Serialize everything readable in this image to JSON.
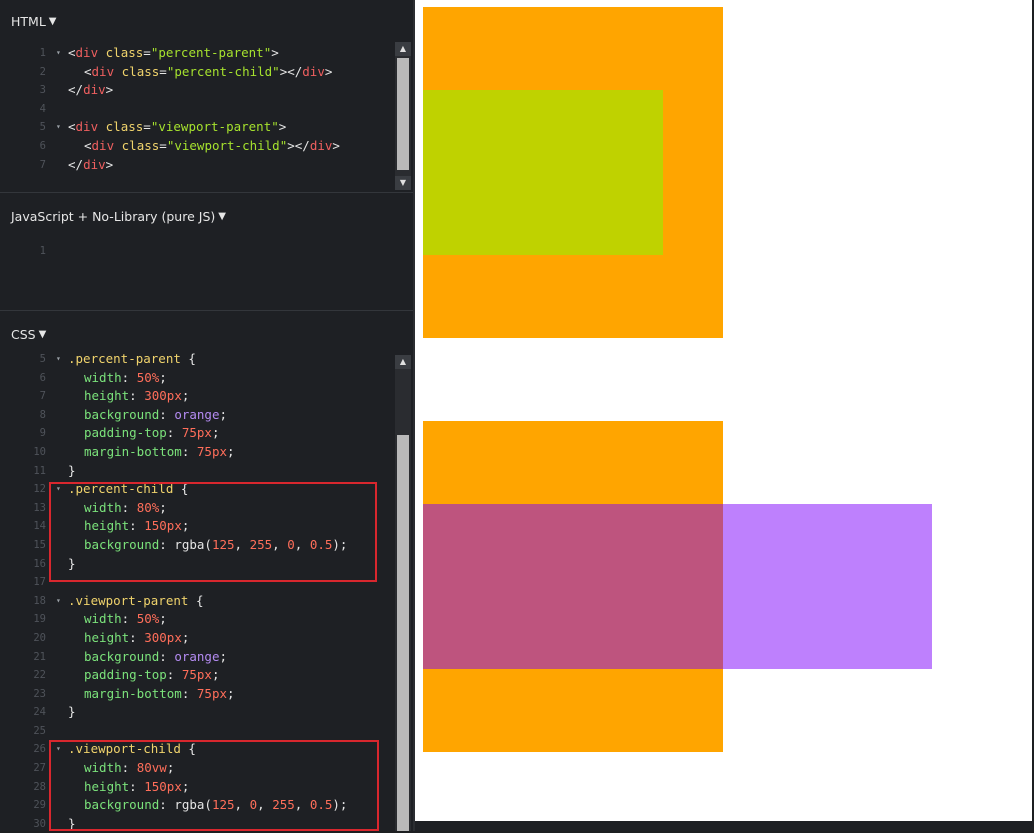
{
  "html_panel": {
    "title": "HTML",
    "lines": [
      {
        "n": "1",
        "indent": 0,
        "fold": true,
        "tokens": [
          [
            "t-plain",
            "<"
          ],
          [
            "t-tag",
            "div"
          ],
          [
            "t-plain",
            " "
          ],
          [
            "t-attr",
            "class"
          ],
          [
            "t-plain",
            "="
          ],
          [
            "t-str",
            "\"percent-parent\""
          ],
          [
            "t-plain",
            ">"
          ]
        ]
      },
      {
        "n": "2",
        "indent": 1,
        "fold": false,
        "tokens": [
          [
            "t-plain",
            "<"
          ],
          [
            "t-tag",
            "div"
          ],
          [
            "t-plain",
            " "
          ],
          [
            "t-attr",
            "class"
          ],
          [
            "t-plain",
            "="
          ],
          [
            "t-str",
            "\"percent-child\""
          ],
          [
            "t-plain",
            "></"
          ],
          [
            "t-tag",
            "div"
          ],
          [
            "t-plain",
            ">"
          ]
        ]
      },
      {
        "n": "3",
        "indent": 0,
        "fold": false,
        "tokens": [
          [
            "t-plain",
            "</"
          ],
          [
            "t-tag",
            "div"
          ],
          [
            "t-plain",
            ">"
          ]
        ]
      },
      {
        "n": "4",
        "indent": 0,
        "fold": false,
        "tokens": []
      },
      {
        "n": "5",
        "indent": 0,
        "fold": true,
        "tokens": [
          [
            "t-plain",
            "<"
          ],
          [
            "t-tag",
            "div"
          ],
          [
            "t-plain",
            " "
          ],
          [
            "t-attr",
            "class"
          ],
          [
            "t-plain",
            "="
          ],
          [
            "t-str",
            "\"viewport-parent\""
          ],
          [
            "t-plain",
            ">"
          ]
        ]
      },
      {
        "n": "6",
        "indent": 1,
        "fold": false,
        "tokens": [
          [
            "t-plain",
            "<"
          ],
          [
            "t-tag",
            "div"
          ],
          [
            "t-plain",
            " "
          ],
          [
            "t-attr",
            "class"
          ],
          [
            "t-plain",
            "="
          ],
          [
            "t-str",
            "\"viewport-child\""
          ],
          [
            "t-plain",
            "></"
          ],
          [
            "t-tag",
            "div"
          ],
          [
            "t-plain",
            ">"
          ]
        ]
      },
      {
        "n": "7",
        "indent": 0,
        "fold": false,
        "tokens": [
          [
            "t-plain",
            "</"
          ],
          [
            "t-tag",
            "div"
          ],
          [
            "t-plain",
            ">"
          ]
        ]
      }
    ]
  },
  "js_panel": {
    "title": "JavaScript + No-Library (pure JS)",
    "lines": [
      {
        "n": "1",
        "indent": 0,
        "fold": false,
        "tokens": []
      }
    ]
  },
  "css_panel": {
    "title": "CSS",
    "lines": [
      {
        "n": "5",
        "indent": 0,
        "fold": true,
        "tokens": [
          [
            "t-sel",
            ".percent-parent"
          ],
          [
            "t-plain",
            " {"
          ]
        ]
      },
      {
        "n": "6",
        "indent": 1,
        "fold": false,
        "tokens": [
          [
            "t-prop",
            "width"
          ],
          [
            "t-plain",
            ": "
          ],
          [
            "t-num",
            "50%"
          ],
          [
            "t-plain",
            ";"
          ]
        ]
      },
      {
        "n": "7",
        "indent": 1,
        "fold": false,
        "tokens": [
          [
            "t-prop",
            "height"
          ],
          [
            "t-plain",
            ": "
          ],
          [
            "t-num",
            "300px"
          ],
          [
            "t-plain",
            ";"
          ]
        ]
      },
      {
        "n": "8",
        "indent": 1,
        "fold": false,
        "tokens": [
          [
            "t-prop",
            "background"
          ],
          [
            "t-plain",
            ": "
          ],
          [
            "t-kw",
            "orange"
          ],
          [
            "t-plain",
            ";"
          ]
        ]
      },
      {
        "n": "9",
        "indent": 1,
        "fold": false,
        "tokens": [
          [
            "t-prop",
            "padding-top"
          ],
          [
            "t-plain",
            ": "
          ],
          [
            "t-num",
            "75px"
          ],
          [
            "t-plain",
            ";"
          ]
        ]
      },
      {
        "n": "10",
        "indent": 1,
        "fold": false,
        "tokens": [
          [
            "t-prop",
            "margin-bottom"
          ],
          [
            "t-plain",
            ": "
          ],
          [
            "t-num",
            "75px"
          ],
          [
            "t-plain",
            ";"
          ]
        ]
      },
      {
        "n": "11",
        "indent": 0,
        "fold": false,
        "tokens": [
          [
            "t-plain",
            "}"
          ]
        ]
      },
      {
        "n": "12",
        "indent": 0,
        "fold": true,
        "tokens": [
          [
            "t-sel",
            ".percent-child"
          ],
          [
            "t-plain",
            " {"
          ]
        ]
      },
      {
        "n": "13",
        "indent": 1,
        "fold": false,
        "tokens": [
          [
            "t-prop",
            "width"
          ],
          [
            "t-plain",
            ": "
          ],
          [
            "t-num",
            "80%"
          ],
          [
            "t-plain",
            ";"
          ]
        ]
      },
      {
        "n": "14",
        "indent": 1,
        "fold": false,
        "tokens": [
          [
            "t-prop",
            "height"
          ],
          [
            "t-plain",
            ": "
          ],
          [
            "t-num",
            "150px"
          ],
          [
            "t-plain",
            ";"
          ]
        ]
      },
      {
        "n": "15",
        "indent": 1,
        "fold": false,
        "tokens": [
          [
            "t-prop",
            "background"
          ],
          [
            "t-plain",
            ": rgba("
          ],
          [
            "t-num",
            "125"
          ],
          [
            "t-plain",
            ", "
          ],
          [
            "t-num",
            "255"
          ],
          [
            "t-plain",
            ", "
          ],
          [
            "t-num",
            "0"
          ],
          [
            "t-plain",
            ", "
          ],
          [
            "t-num",
            "0.5"
          ],
          [
            "t-plain",
            ");"
          ]
        ]
      },
      {
        "n": "16",
        "indent": 0,
        "fold": false,
        "tokens": [
          [
            "t-plain",
            "}"
          ]
        ]
      },
      {
        "n": "17",
        "indent": 0,
        "fold": false,
        "tokens": []
      },
      {
        "n": "18",
        "indent": 0,
        "fold": true,
        "tokens": [
          [
            "t-sel",
            ".viewport-parent"
          ],
          [
            "t-plain",
            " {"
          ]
        ]
      },
      {
        "n": "19",
        "indent": 1,
        "fold": false,
        "tokens": [
          [
            "t-prop",
            "width"
          ],
          [
            "t-plain",
            ": "
          ],
          [
            "t-num",
            "50%"
          ],
          [
            "t-plain",
            ";"
          ]
        ]
      },
      {
        "n": "20",
        "indent": 1,
        "fold": false,
        "tokens": [
          [
            "t-prop",
            "height"
          ],
          [
            "t-plain",
            ": "
          ],
          [
            "t-num",
            "300px"
          ],
          [
            "t-plain",
            ";"
          ]
        ]
      },
      {
        "n": "21",
        "indent": 1,
        "fold": false,
        "tokens": [
          [
            "t-prop",
            "background"
          ],
          [
            "t-plain",
            ": "
          ],
          [
            "t-kw",
            "orange"
          ],
          [
            "t-plain",
            ";"
          ]
        ]
      },
      {
        "n": "22",
        "indent": 1,
        "fold": false,
        "tokens": [
          [
            "t-prop",
            "padding-top"
          ],
          [
            "t-plain",
            ": "
          ],
          [
            "t-num",
            "75px"
          ],
          [
            "t-plain",
            ";"
          ]
        ]
      },
      {
        "n": "23",
        "indent": 1,
        "fold": false,
        "tokens": [
          [
            "t-prop",
            "margin-bottom"
          ],
          [
            "t-plain",
            ": "
          ],
          [
            "t-num",
            "75px"
          ],
          [
            "t-plain",
            ";"
          ]
        ]
      },
      {
        "n": "24",
        "indent": 0,
        "fold": false,
        "tokens": [
          [
            "t-plain",
            "}"
          ]
        ]
      },
      {
        "n": "25",
        "indent": 0,
        "fold": false,
        "tokens": []
      },
      {
        "n": "26",
        "indent": 0,
        "fold": true,
        "tokens": [
          [
            "t-sel",
            ".viewport-child"
          ],
          [
            "t-plain",
            " {"
          ]
        ]
      },
      {
        "n": "27",
        "indent": 1,
        "fold": false,
        "tokens": [
          [
            "t-prop",
            "width"
          ],
          [
            "t-plain",
            ": "
          ],
          [
            "t-num",
            "80vw"
          ],
          [
            "t-plain",
            ";"
          ]
        ]
      },
      {
        "n": "28",
        "indent": 1,
        "fold": false,
        "tokens": [
          [
            "t-prop",
            "height"
          ],
          [
            "t-plain",
            ": "
          ],
          [
            "t-num",
            "150px"
          ],
          [
            "t-plain",
            ";"
          ]
        ]
      },
      {
        "n": "29",
        "indent": 1,
        "fold": false,
        "tokens": [
          [
            "t-prop",
            "background"
          ],
          [
            "t-plain",
            ": rgba("
          ],
          [
            "t-num",
            "125"
          ],
          [
            "t-plain",
            ", "
          ],
          [
            "t-num",
            "0"
          ],
          [
            "t-plain",
            ", "
          ],
          [
            "t-num",
            "255"
          ],
          [
            "t-plain",
            ", "
          ],
          [
            "t-num",
            "0.5"
          ],
          [
            "t-plain",
            ");"
          ]
        ]
      },
      {
        "n": "30",
        "indent": 0,
        "fold": false,
        "tokens": [
          [
            "t-plain",
            "}"
          ]
        ]
      }
    ]
  },
  "glyphs": {
    "caret": "▼",
    "fold_marker": "▾",
    "scroll_up": "▲",
    "scroll_down": "▼"
  },
  "colors": {
    "orange": "#ffa500",
    "percent_child": "#bfd200",
    "viewport_child_over_orange": "#be547e",
    "viewport_child_over_white": "#be80fd",
    "highlight_box": "#d9272e"
  }
}
